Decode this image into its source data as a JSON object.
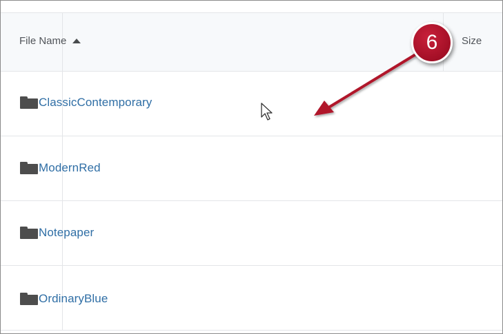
{
  "table": {
    "header": {
      "file_name_label": "File Name",
      "size_label": "Size",
      "sort_direction": "ascending"
    },
    "rows": [
      {
        "name": "ClassicContemporary",
        "type_icon": "folder-icon"
      },
      {
        "name": "ModernRed",
        "type_icon": "folder-icon"
      },
      {
        "name": "Notepaper",
        "type_icon": "folder-icon"
      },
      {
        "name": "OrdinaryBlue",
        "type_icon": "folder-icon"
      }
    ]
  },
  "annotation": {
    "step_number": "6",
    "badge_color": "#a30f26",
    "arrow_color": "#b0142c"
  },
  "colors": {
    "link": "#2f6ea5",
    "header_text": "#505459",
    "folder": "#4d4d4d",
    "header_bg": "#f7f9fb"
  }
}
